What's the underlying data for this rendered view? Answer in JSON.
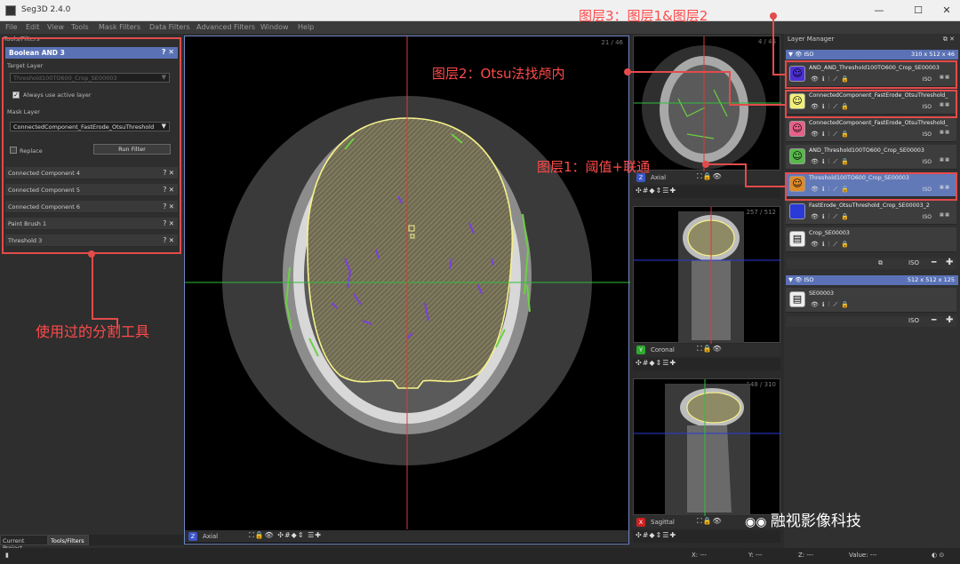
{
  "window": {
    "title": "Seg3D 2.4.0",
    "controls": [
      "—",
      "☐",
      "✕"
    ]
  },
  "menu": [
    "File",
    "Edit",
    "View",
    "Tools",
    "Mask Filters",
    "Data Filters",
    "Advanced Filters",
    "Window",
    "Help"
  ],
  "tools_panel": {
    "title": "Tools/Filters",
    "boolean": {
      "name": "Boolean AND 3",
      "target_layer_label": "Target Layer",
      "target_layer_value": "Threshold100TO600_Crop_SE00003",
      "always_use_active": "Always use active layer",
      "mask_layer_label": "Mask Layer",
      "mask_layer_value": "ConnectedComponent_FastErode_OtsuThreshold",
      "replace_label": "Replace",
      "run_filter": "Run Filter"
    },
    "tools": [
      "Connected Component 4",
      "Connected Component 5",
      "Connected Component 6",
      "Paint Brush 1",
      "Threshold 3"
    ],
    "bottom_tabs": [
      "Current Project",
      "Tools/Filters"
    ]
  },
  "main_viewer": {
    "slice": "21 / 46",
    "axis": "Z",
    "label": "Axial"
  },
  "small_views": [
    {
      "slice": "4 / 46",
      "axis": "Z",
      "label": "Axial",
      "color": "#3a56c9"
    },
    {
      "slice": "257 / 512",
      "axis": "Y",
      "label": "Coronal",
      "color": "#2eaa2e"
    },
    {
      "slice": "148 / 310",
      "axis": "X",
      "label": "Sagittal",
      "color": "#d02020"
    }
  ],
  "layer_manager": {
    "title": "Layer Manager",
    "group1": {
      "label": "ISO",
      "dims": "310 x 512 x 46"
    },
    "layers": [
      {
        "name": "AND_AND_Threshold100TO600_Crop_SE00003",
        "color": "#4b2fd6",
        "icon": "☺"
      },
      {
        "name": "ConnectedComponent_FastErode_OtsuThreshold_",
        "color": "#f2f07a",
        "icon": "☺"
      },
      {
        "name": "ConnectedComponent_FastErode_OtsuThreshold_",
        "color": "#e8608a",
        "icon": "☺"
      },
      {
        "name": "AND_Threshold100TO600_Crop_SE00003",
        "color": "#57b84a",
        "icon": "☺"
      },
      {
        "name": "Threshold100TO600_Crop_SE00003",
        "color": "#e08a2a",
        "icon": "☺"
      },
      {
        "name": "FastErode_OtsuThreshold_Crop_SE00003_2",
        "color": "#2a3ad8",
        "icon": ""
      },
      {
        "name": "Crop_SE00003",
        "color": "#eeeeee",
        "icon": "▤"
      }
    ],
    "iso": "ISO",
    "group2": {
      "label": "ISO",
      "dims": "512 x 512 x 125"
    },
    "layer2": {
      "name": "SE00003"
    }
  },
  "status": {
    "x": "X: ---",
    "y": "Y: ---",
    "z": "Z: ---",
    "value": "Value: ---"
  },
  "annotations": {
    "layer3": "图层3：图层1&图层2",
    "layer2": "图层2：Otsu法找颅内",
    "layer1": "图层1：阈值+联通",
    "tools": "使用过的分割工具"
  },
  "watermark": "融视影像科技"
}
